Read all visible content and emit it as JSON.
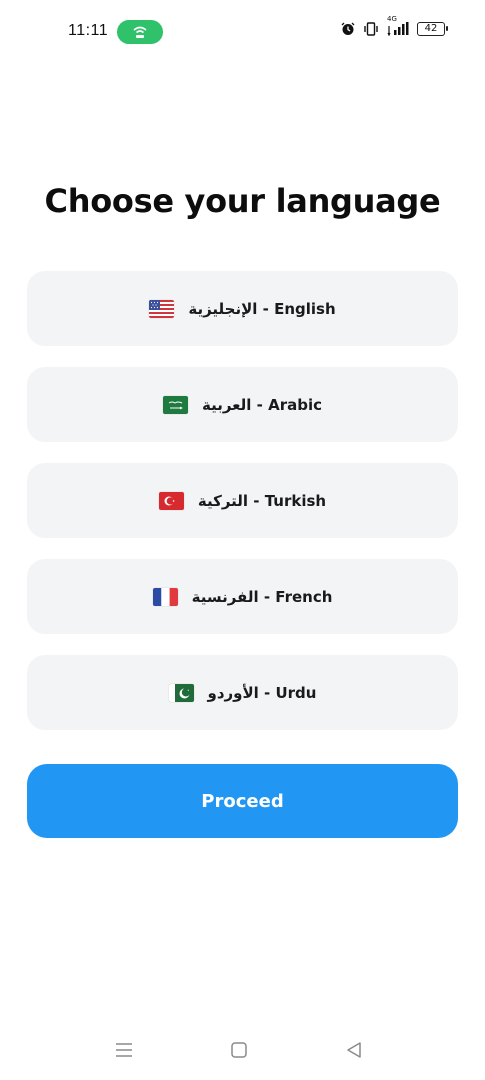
{
  "status_bar": {
    "time": "11:11",
    "battery_level": "42",
    "network_label": "4G",
    "hotspot_color": "#2fc26a",
    "icons": [
      "hotspot-icon",
      "alarm-icon",
      "vibrate-icon",
      "signal-icon",
      "battery-icon"
    ]
  },
  "title": "Choose your language",
  "languages": [
    {
      "label": "الإنجليزية - English",
      "flag": "us-flag-icon"
    },
    {
      "label": "العربية - Arabic",
      "flag": "saudi-flag-icon"
    },
    {
      "label": "التركية - Turkish",
      "flag": "turkey-flag-icon"
    },
    {
      "label": "الفرنسية - French",
      "flag": "france-flag-icon"
    },
    {
      "label": "الأوردو - Urdu",
      "flag": "pakistan-flag-icon"
    }
  ],
  "proceed_label": "Proceed",
  "colors": {
    "accent": "#2196f3",
    "option_bg": "#f3f4f6"
  },
  "nav": {
    "icons": [
      "menu-icon",
      "home-icon",
      "back-icon"
    ]
  }
}
